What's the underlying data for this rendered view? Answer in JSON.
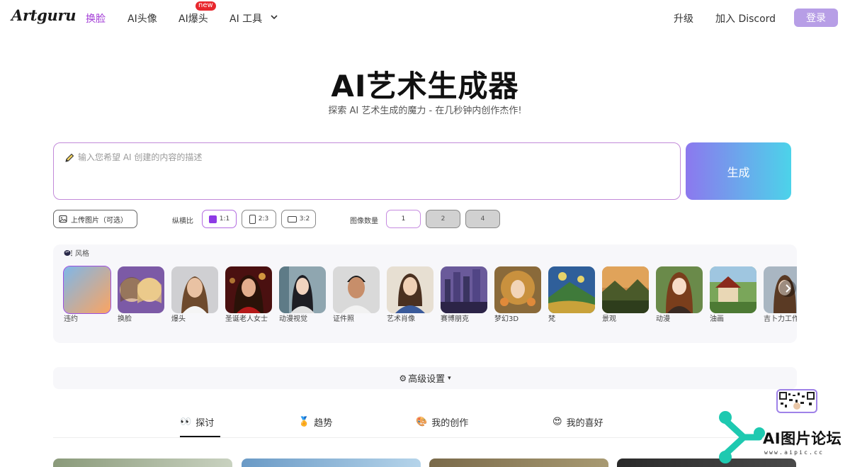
{
  "header": {
    "logo": "Artguru",
    "nav": [
      {
        "label": "换脸",
        "active": true
      },
      {
        "label": "AI头像",
        "active": false
      },
      {
        "label": "AI爆头",
        "active": false,
        "badge": "new"
      },
      {
        "label": "AI 工具",
        "active": false,
        "has_dropdown": true
      }
    ],
    "upgrade": "升级",
    "discord": "加入 Discord",
    "login": "登录"
  },
  "hero": {
    "title": "AI艺术生成器",
    "subtitle": "探索 AI 艺术生成的魔力 - 在几秒钟内创作杰作!"
  },
  "prompt": {
    "placeholder": "输入您希望 AI 创建的内容的描述",
    "value": "",
    "generate_label": "生成"
  },
  "options": {
    "upload_label": "上传图片（可选）",
    "ratio_label": "纵横比",
    "ratios": [
      {
        "label": "1:1",
        "selected": true
      },
      {
        "label": "2:3",
        "selected": false
      },
      {
        "label": "3:2",
        "selected": false
      }
    ],
    "count_label": "图像数量",
    "counts": [
      {
        "label": "1",
        "selected": true
      },
      {
        "label": "2",
        "selected": false
      },
      {
        "label": "4",
        "selected": false
      }
    ]
  },
  "styles": {
    "header": "风格",
    "items": [
      {
        "name": "违约",
        "selected": true
      },
      {
        "name": "换脸",
        "selected": false
      },
      {
        "name": "爆头",
        "selected": false
      },
      {
        "name": "圣诞老人女士",
        "selected": false
      },
      {
        "name": "动漫视觉",
        "selected": false
      },
      {
        "name": "证件照",
        "selected": false
      },
      {
        "name": "艺术肖像",
        "selected": false
      },
      {
        "name": "赛博朋克",
        "selected": false
      },
      {
        "name": "梦幻3D",
        "selected": false
      },
      {
        "name": "梵",
        "selected": false
      },
      {
        "name": "景观",
        "selected": false
      },
      {
        "name": "动漫",
        "selected": false
      },
      {
        "name": "油画",
        "selected": false
      },
      {
        "name": "吉卜力工作室",
        "selected": false
      }
    ]
  },
  "advanced": {
    "label": "高级设置"
  },
  "tabs": [
    {
      "label": "探讨",
      "icon": "👀",
      "active": true
    },
    {
      "label": "趋势",
      "icon": "🏅",
      "active": false
    },
    {
      "label": "我的创作",
      "icon": "🎨",
      "active": false
    },
    {
      "label": "我的喜好",
      "icon": "😍",
      "active": false
    }
  ],
  "watermark": {
    "text": "AI图片论坛",
    "url": "www.aipic.cc"
  },
  "colors": {
    "accent": "#a23bd6",
    "login_bg": "#b79ee6",
    "generate_from": "#8c78ee",
    "generate_to": "#4cd3ea",
    "selected_ratio": "#8e3ae5"
  }
}
